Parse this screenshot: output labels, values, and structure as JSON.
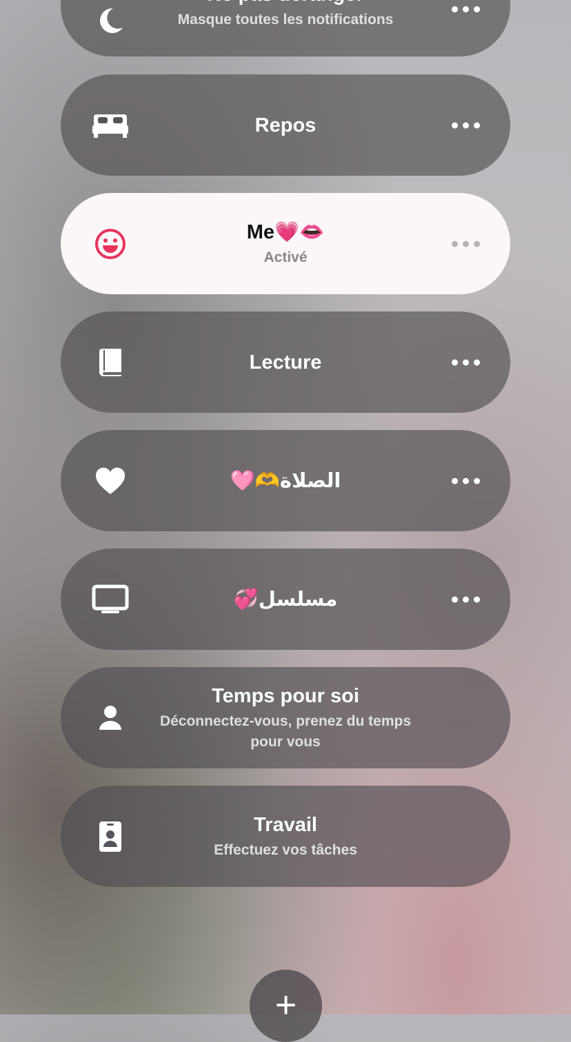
{
  "focus_modes": [
    {
      "title": "Ne pas déranger",
      "subtitle": "Masque toutes les notifications",
      "icon": "moon-icon",
      "has_more": true,
      "active": false
    },
    {
      "title": "Repos",
      "subtitle": "",
      "icon": "bed-icon",
      "has_more": true,
      "active": false
    },
    {
      "title": "Me💗👄",
      "subtitle": "Activé",
      "icon": "smiley-icon",
      "has_more": true,
      "active": true
    },
    {
      "title": "Lecture",
      "subtitle": "",
      "icon": "book-icon",
      "has_more": true,
      "active": false
    },
    {
      "title": "🩷🫶الصلاة",
      "subtitle": "",
      "icon": "heart-icon",
      "has_more": true,
      "active": false
    },
    {
      "title": "💞مسلسل",
      "subtitle": "",
      "icon": "tv-icon",
      "has_more": true,
      "active": false
    },
    {
      "title": "Temps pour soi",
      "subtitle": "Déconnectez-vous, prenez du temps pour vous",
      "icon": "person-icon",
      "has_more": false,
      "active": false
    },
    {
      "title": "Travail",
      "subtitle": "Effectuez vos tâches",
      "icon": "id-badge-icon",
      "has_more": false,
      "active": false
    }
  ],
  "add_button": {
    "label": "+"
  },
  "colors": {
    "active_icon": "#e8335c",
    "pill_bg": "#4e4a4e",
    "active_bg": "#fbf7f8"
  }
}
